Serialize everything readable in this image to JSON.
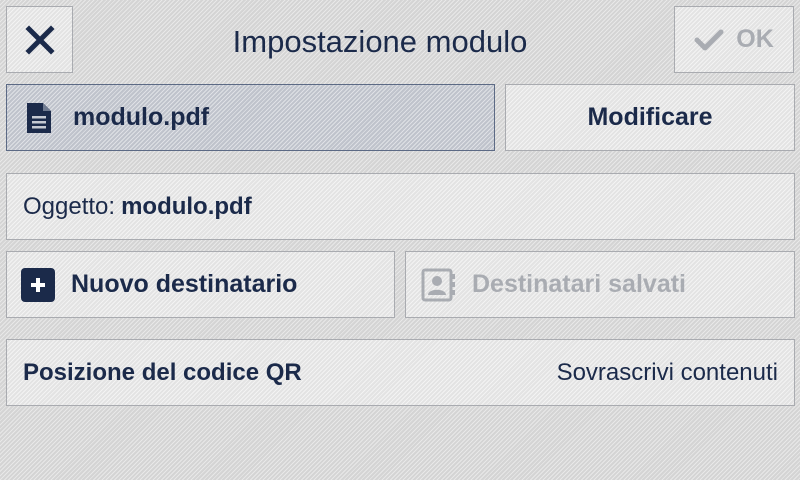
{
  "header": {
    "title": "Impostazione modulo",
    "ok_label": "OK"
  },
  "file": {
    "name": "modulo.pdf",
    "edit_label": "Modificare"
  },
  "subject": {
    "label": "Oggetto:",
    "value": "modulo.pdf"
  },
  "recipients": {
    "new_label": "Nuovo destinatario",
    "saved_label": "Destinatari salvati"
  },
  "qr": {
    "label": "Posizione del codice QR",
    "value": "Sovrascrivi contenuti"
  },
  "icons": {
    "close": "close-icon",
    "ok": "checkmark-icon",
    "file": "document-icon",
    "new_recipient": "plus-icon",
    "saved_recipients": "address-book-icon"
  },
  "colors": {
    "text": "#1b2a4a",
    "disabled": "#a9acb2",
    "selected_bg": "#c5c9d2",
    "selected_border": "#5c6a85"
  }
}
